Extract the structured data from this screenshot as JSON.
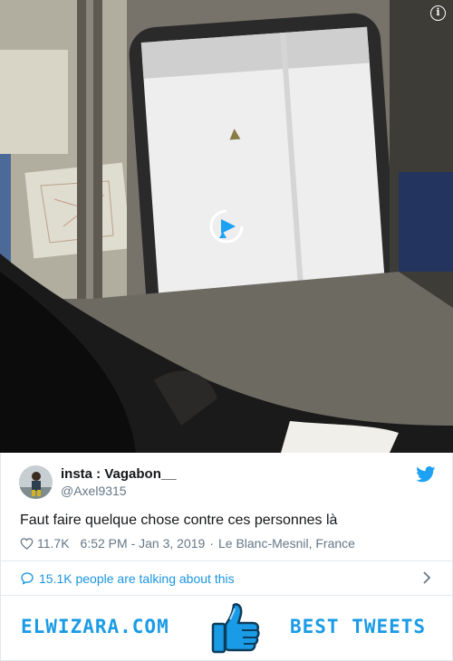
{
  "video": {
    "info_icon": "info-icon",
    "play_icon": "play-circle-icon"
  },
  "tweet": {
    "author_name": "insta : Vagabon__",
    "author_handle": "@Axel9315",
    "text": "Faut faire quelque chose contre ces personnes là",
    "likes": "11.7K",
    "timestamp": "6:52 PM - Jan 3, 2019",
    "separator": "·",
    "location": "Le Blanc-Mesnil, France",
    "talking": "15.1K people are talking about this",
    "brand_color": "#1da1f2",
    "link_color": "#1b95e0"
  },
  "promo": {
    "left_text": "ELWIZARA.COM",
    "right_text": "BEST TWEETS",
    "icon": "thumbs-up-icon",
    "color": "#1a9be6"
  }
}
